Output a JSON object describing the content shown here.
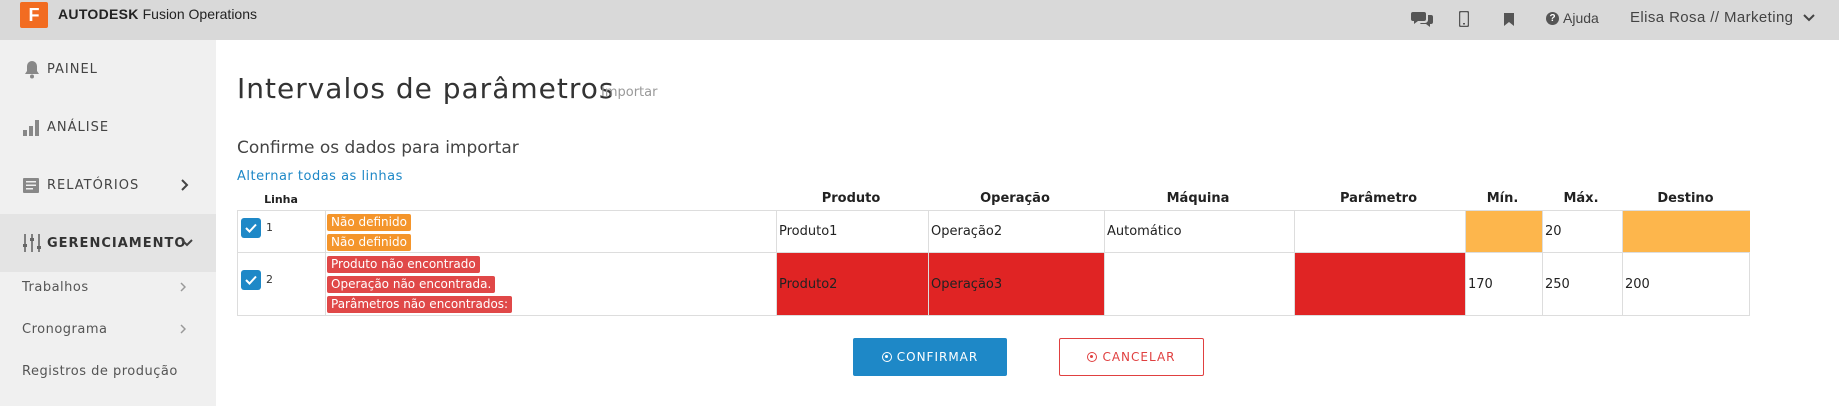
{
  "app": {
    "logo_letter": "F",
    "brand_bold": "AUTODESK",
    "brand_rest": "Fusion Operations",
    "help_label": "Ajuda",
    "user_label": "Elisa Rosa // Marketing"
  },
  "sidebar": {
    "items": [
      {
        "label": "PAINEL",
        "icon": "bell-icon"
      },
      {
        "label": "ANÁLISE",
        "icon": "bar-chart-icon"
      },
      {
        "label": "RELATÓRIOS",
        "icon": "reports-icon"
      },
      {
        "label": "GERENCIAMENTO",
        "icon": "sliders-icon"
      }
    ],
    "subitems": [
      {
        "label": "Trabalhos"
      },
      {
        "label": "Cronograma"
      },
      {
        "label": "Registros de produção"
      }
    ]
  },
  "page": {
    "title": "Intervalos de parâmetros",
    "subtitle": "Importar",
    "confirm_heading": "Confirme os dados para importar",
    "toggle_all": "Alternar todas as linhas"
  },
  "table": {
    "headers": {
      "linha": "Linha",
      "produto": "Produto",
      "operacao": "Operação",
      "maquina": "Máquina",
      "parametro": "Parâmetro",
      "min": "Mín.",
      "max": "Máx.",
      "destino": "Destino"
    },
    "rows": [
      {
        "num": "1",
        "checked": true,
        "badges": [
          "Não definido",
          "Não definido"
        ],
        "produto": "Produto1",
        "operacao": "Operação2",
        "maquina": "Automático",
        "parametro": "",
        "min": "",
        "max": "20",
        "destino": ""
      },
      {
        "num": "2",
        "checked": true,
        "badges": [
          "Produto não encontrado",
          "Operação não encontrada.",
          "Parâmetros não encontrados:"
        ],
        "produto": "Produto2",
        "operacao": "Operação3",
        "maquina": "",
        "parametro": "",
        "min": "170",
        "max": "250",
        "destino": "200"
      }
    ]
  },
  "buttons": {
    "confirm": "CONFIRMAR",
    "cancel": "CANCELAR"
  },
  "colors": {
    "accent": "#1e88c7",
    "warning": "#fdb64c",
    "error": "#e02424",
    "logo": "#f26c21"
  }
}
